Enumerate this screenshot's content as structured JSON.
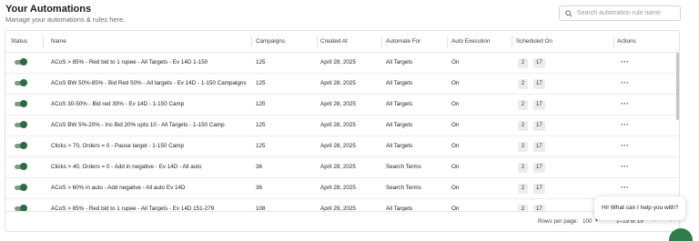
{
  "header": {
    "title": "Your Automations",
    "subtitle": "Manage your automations & rules here."
  },
  "search": {
    "placeholder": "Search automation rule name",
    "value": ""
  },
  "columns": [
    "Status",
    "Name",
    "Campaigns",
    "Created At",
    "Automate For",
    "Auto Execution",
    "Scheduled On",
    "Actions"
  ],
  "rows": [
    {
      "status": "on",
      "name": "ACoS > 85% - Red bid to 1 rupee - All Targets - Ev 14D 1-150",
      "campaigns": "125",
      "created": "April 28, 2025",
      "automate_for": "All Targets",
      "auto_exec": "On",
      "sched_a": "2",
      "sched_b": "17"
    },
    {
      "status": "on",
      "name": "ACoS BW 50%-85% - Bid Red 50% - All targets - Ev 14D - 1-150 Campaigns",
      "campaigns": "125",
      "created": "April 28, 2025",
      "automate_for": "All Targets",
      "auto_exec": "On",
      "sched_a": "2",
      "sched_b": "17"
    },
    {
      "status": "on",
      "name": "ACoS 30-50% - Bid red 30% - Ev 14D - 1-150 Camp",
      "campaigns": "125",
      "created": "April 28, 2025",
      "automate_for": "All Targets",
      "auto_exec": "On",
      "sched_a": "2",
      "sched_b": "17"
    },
    {
      "status": "on",
      "name": "ACoS BW 5%-20% - Inc Bid 20% upto 10 - All Targets - 1-150 Camp",
      "campaigns": "125",
      "created": "April 28, 2025",
      "automate_for": "All Targets",
      "auto_exec": "On",
      "sched_a": "2",
      "sched_b": "17"
    },
    {
      "status": "on",
      "name": "Clicks > 70, Orders = 0 - Pause target - 1-150 Camp",
      "campaigns": "125",
      "created": "April 28, 2025",
      "automate_for": "All Targets",
      "auto_exec": "On",
      "sched_a": "2",
      "sched_b": "17"
    },
    {
      "status": "on",
      "name": "Clicks > 40, Orders = 0 - Add in negative - Ev 14D - All auto",
      "campaigns": "36",
      "created": "April 28, 2025",
      "automate_for": "Search Terms",
      "auto_exec": "On",
      "sched_a": "2",
      "sched_b": "17"
    },
    {
      "status": "on",
      "name": "ACoS > 60% in auto - Add negative - All auto Ev 14D",
      "campaigns": "36",
      "created": "April 28, 2025",
      "automate_for": "Search Terms",
      "auto_exec": "On",
      "sched_a": "2",
      "sched_b": "17"
    },
    {
      "status": "on",
      "name": "ACoS > 85% - Red bid to 1 rupee - All Targets - Ev 14D 151-279",
      "campaigns": "108",
      "created": "April 29, 2025",
      "automate_for": "All Targets",
      "auto_exec": "On",
      "sched_a": "2",
      "sched_b": "17"
    }
  ],
  "actions_glyph": "···",
  "pagination": {
    "rows_per_page_label": "Rows per page:",
    "rows_per_page_value": "100",
    "range": "1–19 of 19",
    "prev_glyph": "‹",
    "next_glyph": "›"
  },
  "chat": {
    "message": "Hi! What can I help you with?"
  },
  "colors": {
    "toggle_on": "#2f6a43",
    "chat_fab": "#2e7d4a"
  }
}
